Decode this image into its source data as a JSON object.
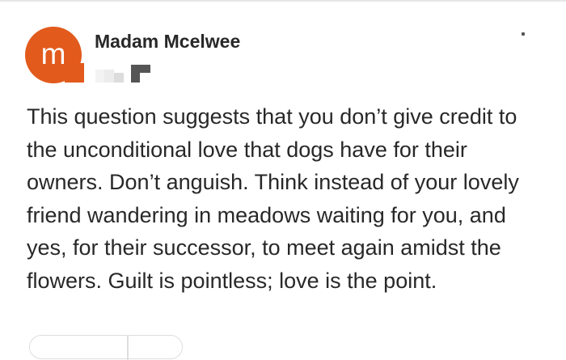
{
  "post": {
    "avatar_letter": "m",
    "author_name": "Madam Mcelwee",
    "answer_text": "This question suggests that you don’t give credit to the unconditional love that dogs have for their owners. Don’t anguish. Think instead of your lovely friend wandering in meadows waiting for you, and yes, for their successor, to meet again amidst the flowers. Guilt is pointless; love is the point."
  },
  "icons": {
    "more": "more-options-icon"
  },
  "colors": {
    "avatar_bg": "#e25a1c",
    "text": "#282829"
  }
}
